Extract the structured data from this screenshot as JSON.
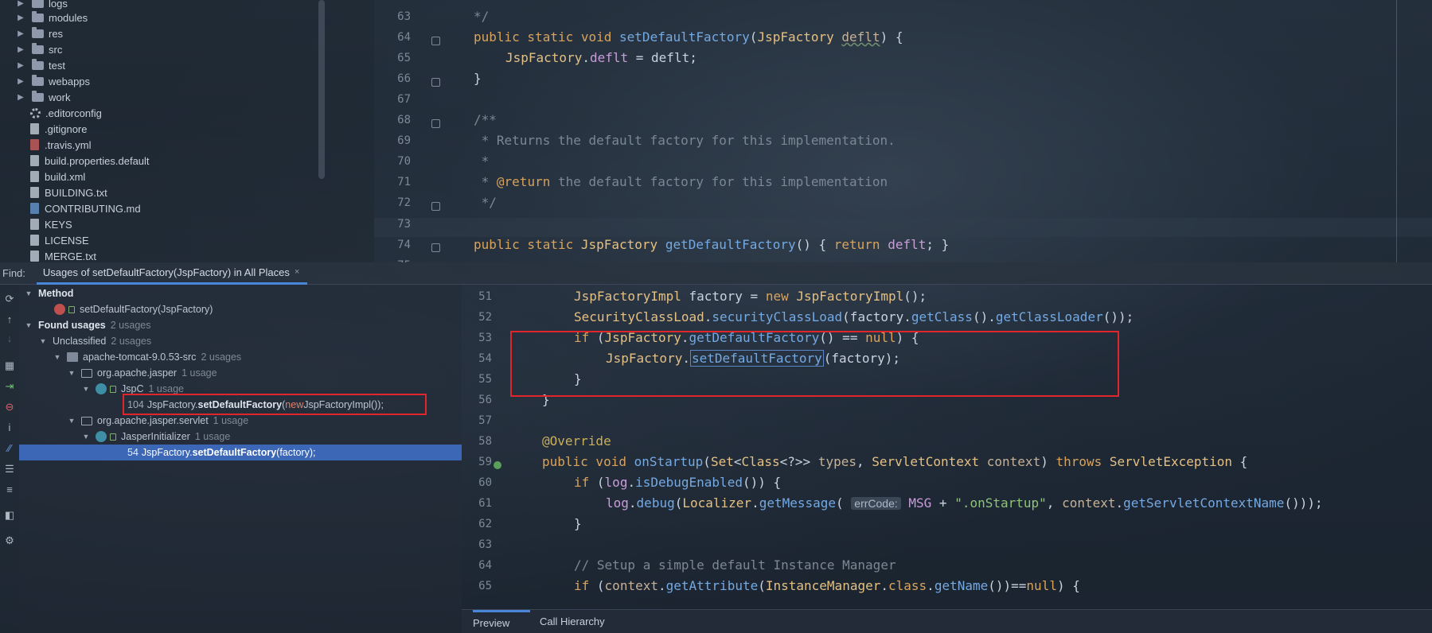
{
  "project_tree": {
    "items": [
      {
        "label": "logs",
        "kind": "folder"
      },
      {
        "label": "modules",
        "kind": "folder"
      },
      {
        "label": "res",
        "kind": "folder"
      },
      {
        "label": "src",
        "kind": "folder"
      },
      {
        "label": "test",
        "kind": "folder"
      },
      {
        "label": "webapps",
        "kind": "folder"
      },
      {
        "label": "work",
        "kind": "folder"
      },
      {
        "label": ".editorconfig",
        "kind": "config"
      },
      {
        "label": ".gitignore",
        "kind": "file"
      },
      {
        "label": ".travis.yml",
        "kind": "yml"
      },
      {
        "label": "build.properties.default",
        "kind": "file"
      },
      {
        "label": "build.xml",
        "kind": "file"
      },
      {
        "label": "BUILDING.txt",
        "kind": "file"
      },
      {
        "label": "CONTRIBUTING.md",
        "kind": "md"
      },
      {
        "label": "KEYS",
        "kind": "file"
      },
      {
        "label": "LICENSE",
        "kind": "file"
      },
      {
        "label": "MERGE.txt",
        "kind": "file"
      }
    ]
  },
  "editor_top": {
    "line_numbers": [
      "63",
      "64",
      "65",
      "66",
      "67",
      "68",
      "69",
      "70",
      "71",
      "72",
      "73",
      "74",
      "75"
    ],
    "lines": {
      "l63": "*/",
      "l64_kw": "public static void ",
      "l64_fn": "setDefaultFactory",
      "l64_open": "(",
      "l64_type": "JspFactory ",
      "l64_param": "deflt",
      "l64_close": ") {",
      "l65_type": "JspFactory",
      "l65_dot": ".",
      "l65_field": "deflt",
      "l65_rest": " = deflt;",
      "l66": "}",
      "l68": "/**",
      "l69": " * Returns the default factory for this implementation.",
      "l70": " *",
      "l71_star": " * ",
      "l71_tag": "@return",
      "l71_rest": " the default factory for this implementation",
      "l72": " */",
      "l74_kw": "public static ",
      "l74_type": "JspFactory ",
      "l74_fn": "getDefaultFactory",
      "l74_mid": "() { ",
      "l74_ret": "return ",
      "l74_field": "deflt",
      "l74_end": "; }"
    }
  },
  "find_bar": {
    "label": "Find:",
    "tab_label": "Usages of setDefaultFactory(JspFactory) in All Places",
    "close": "×"
  },
  "side_tools": [
    "rerun-icon",
    "up-icon",
    "down-icon",
    "group-icon",
    "navigate-icon",
    "exclude-icon",
    "info-icon",
    "merge-icon",
    "expand-icon",
    "collapse-icon",
    "preview-icon",
    "settings-icon"
  ],
  "results": {
    "method_header": "Method",
    "method_name": "setDefaultFactory(JspFactory)",
    "found_usages": "Found usages",
    "found_count": "2 usages",
    "unclassified": "Unclassified",
    "unclassified_count": "2 usages",
    "project": "apache-tomcat-9.0.53-src",
    "project_count": "2 usages",
    "pkg1": "org.apache.jasper",
    "pkg1_count": "1 usage",
    "cls1": "JspC",
    "cls1_count": "1 usage",
    "usage1_line": "104",
    "usage1_prefix": "JspFactory.",
    "usage1_method": "setDefaultFactory",
    "usage1_open": "(",
    "usage1_new": "new",
    "usage1_rest": " JspFactoryImpl());",
    "pkg2": "org.apache.jasper.servlet",
    "pkg2_count": "1 usage",
    "cls2": "JasperInitializer",
    "cls2_count": "1 usage",
    "usage2_line": "54",
    "usage2_prefix": "JspFactory.",
    "usage2_method": "setDefaultFactory",
    "usage2_rest": "(factory);"
  },
  "editor_bottom": {
    "line_numbers": [
      "51",
      "52",
      "53",
      "54",
      "55",
      "56",
      "57",
      "58",
      "59",
      "60",
      "61",
      "62",
      "63",
      "64",
      "65"
    ],
    "lines": {
      "l51_type": "JspFactoryImpl",
      "l51_mid": " factory = ",
      "l51_kw": "new ",
      "l51_type2": "JspFactoryImpl",
      "l51_end": "();",
      "l52_type": "SecurityClassLoad",
      "l52_dot": ".",
      "l52_fn": "securityClassLoad",
      "l52_mid": "(factory.",
      "l52_fn2": "getClass",
      "l52_mid2": "().",
      "l52_fn3": "getClassLoader",
      "l52_end": "());",
      "l53_kw": "if ",
      "l53_open": "(",
      "l53_type": "JspFactory",
      "l53_dot": ".",
      "l53_fn": "getDefaultFactory",
      "l53_mid": "() == ",
      "l53_null": "null",
      "l53_end": ") {",
      "l54_type": "JspFactory",
      "l54_dot": ".",
      "l54_fn": "setDefaultFactory",
      "l54_end": "(factory);",
      "l55": "}",
      "l56": "}",
      "l58": "@Override",
      "l59_kw": "public void ",
      "l59_fn": "onStartup",
      "l59_open": "(",
      "l59_type": "Set",
      "l59_gen": "<",
      "l59_type2": "Class",
      "l59_gen2": "<?>> ",
      "l59_p1": "types",
      "l59_comma": ", ",
      "l59_type3": "ServletContext ",
      "l59_p2": "context",
      "l59_close": ") ",
      "l59_throws": "throws ",
      "l59_exc": "ServletException",
      "l59_end": " {",
      "l60_kw": "if ",
      "l60_open": "(",
      "l60_fld": "log",
      "l60_dot": ".",
      "l60_fn": "isDebugEnabled",
      "l60_end": "()) {",
      "l61_fld": "log",
      "l61_dot": ".",
      "l61_fn": "debug",
      "l61_open": "(",
      "l61_type": "Localizer",
      "l61_dot2": ".",
      "l61_fn2": "getMessage",
      "l61_open2": "( ",
      "l61_hint": "errCode:",
      "l61_const": " MSG",
      "l61_plus": " + ",
      "l61_str": "\".onStartup\"",
      "l61_comma": ", ",
      "l61_ctx": "context",
      "l61_dot3": ".",
      "l61_fn3": "getServletContextName",
      "l61_end": "()));",
      "l62": "}",
      "l64": "// Setup a simple default Instance Manager",
      "l65_kw": "if ",
      "l65_open": "(",
      "l65_ctx": "context",
      "l65_dot": ".",
      "l65_fn": "getAttribute",
      "l65_open2": "(",
      "l65_type": "InstanceManager",
      "l65_dot2": ".",
      "l65_kw2": "class",
      "l65_dot3": ".",
      "l65_fn2": "getName",
      "l65_mid": "())==",
      "l65_null": "null",
      "l65_end": ") {"
    }
  },
  "bottom_tabs": {
    "preview": "Preview",
    "call_hierarchy": "Call Hierarchy"
  },
  "colors": {
    "selection": "#3c67b6",
    "highlight_box": "#e0262b",
    "tab_underline": "#4a86d8"
  }
}
